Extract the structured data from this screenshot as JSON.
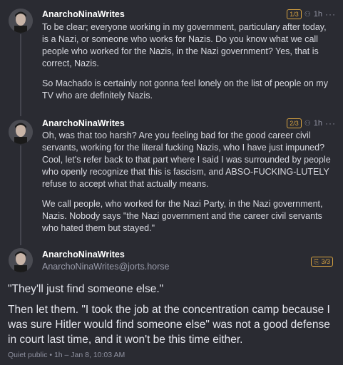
{
  "posts": [
    {
      "author": "AnarchoNinaWrites",
      "badge": "1/3",
      "time": "1h",
      "more": "···",
      "paragraphs": [
        "To be clear; everyone working in my government, particulary after today, is a Nazi, or someone who works for Nazis. Do you know what we call people who worked for the Nazis, in the Nazi government? Yes, that is correct, Nazis.",
        "So Machado is certainly not gonna feel lonely on the list of people on my TV who are definitely Nazis."
      ]
    },
    {
      "author": "AnarchoNinaWrites",
      "badge": "2/3",
      "time": "1h",
      "more": "···",
      "paragraphs": [
        "Oh, was that too harsh? Are you feeling bad for the good career civil servants, working for the literal fucking Nazis, who I have just impuned? Cool, let's refer back to that part where I said I was surrounded by people who openly recognize that this is fascism, and ABSO-FUCKING-LUTELY refuse to accept what that actually means.",
        "We call people, who worked for the Nazi Party, in the Nazi government, Nazis. Nobody says \"the Nazi government and the career civil servants who hated them but stayed.\""
      ]
    }
  ],
  "main_post": {
    "author": "AnarchoNinaWrites",
    "handle": "AnarchoNinaWrites@jorts.horse",
    "badge": "3/3",
    "quote": "\"They'll just find someone else.\"",
    "text": "Then let them. \"I took the job at the concentration camp because I was sure Hitler would find someone else\" was not a good defense in court last time, and it won't be this time either.",
    "footer": "Quiet public • 1h – Jan 8, 10:03 AM"
  },
  "colors": {
    "background": "#2a2b32",
    "accent": "#d9a441"
  }
}
